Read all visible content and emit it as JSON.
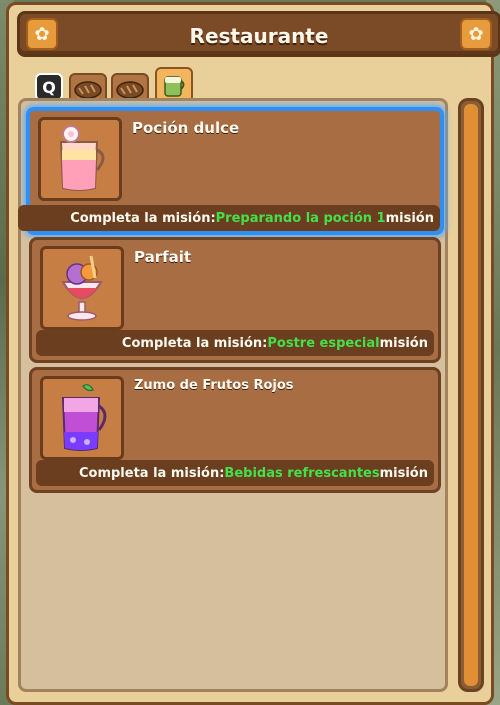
{
  "window": {
    "title": "Restaurante"
  },
  "tabs": {
    "q_label": "Q"
  },
  "recipes": [
    {
      "name": "Poción dulce",
      "prefix": "Completa la misión: ",
      "quest": "Preparando la poción 1",
      "suffix": " misión"
    },
    {
      "name": "Parfait",
      "prefix": "Completa la misión: ",
      "quest": "Postre especial",
      "suffix": " misión"
    },
    {
      "name": "Zumo de Frutos Rojos",
      "prefix": "Completa la misión: ",
      "quest": "Bebidas refrescantes",
      "suffix": " misión"
    }
  ],
  "colors": {
    "quest_highlight": "#44e04a",
    "selection": "#2f8ff5"
  }
}
